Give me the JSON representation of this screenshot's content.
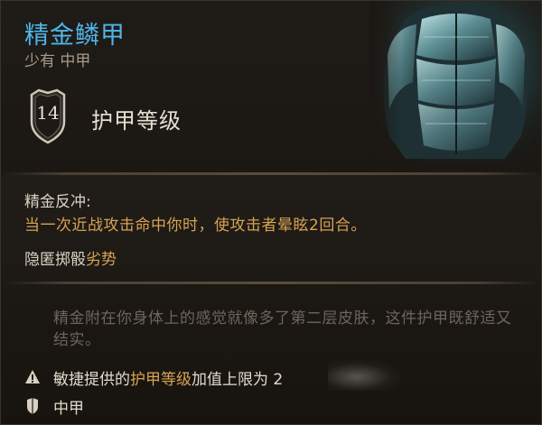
{
  "item": {
    "name": "精金鳞甲",
    "rarity_type": "少有 中甲"
  },
  "armor_class": {
    "value": "14",
    "label": "护甲等级"
  },
  "passive": {
    "title": "精金反冲:",
    "description": "当一次近战攻击命中你时，使攻击者晕眩2回合。"
  },
  "stealth": {
    "prefix": "隐匿掷骰",
    "highlight": "劣势"
  },
  "flavor_text": "精金附在你身体上的感觉就像多了第二层皮肤，这件护甲既舒适又结实。",
  "notes": [
    {
      "icon": "warning-icon",
      "parts": [
        "敏捷提供的",
        "护甲等级",
        "加值上限为 2"
      ]
    },
    {
      "icon": "shield-icon",
      "text": "中甲"
    }
  ],
  "colors": {
    "name": "#4fb5e8",
    "highlight": "#d7a352",
    "flavor": "#6d655b",
    "background": "#1b1814"
  }
}
